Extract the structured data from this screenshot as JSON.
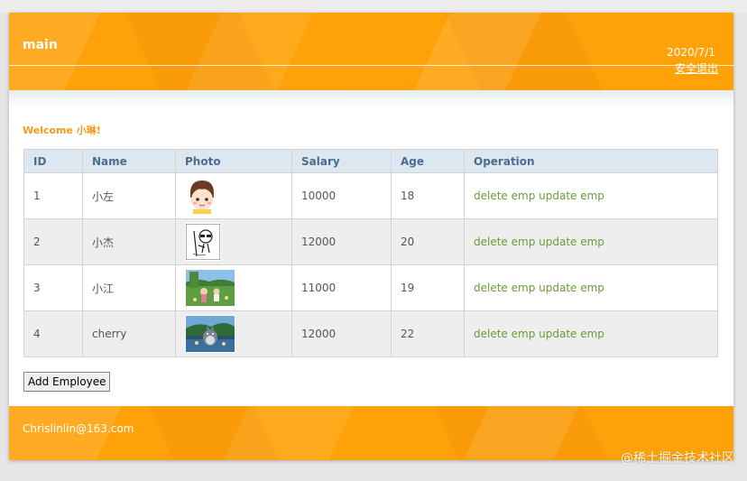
{
  "header": {
    "title": "main",
    "date": "2020/7/1",
    "logout_label": "安全退出"
  },
  "welcome": "Welcome 小琳!",
  "table": {
    "columns": [
      "ID",
      "Name",
      "Photo",
      "Salary",
      "Age",
      "Operation"
    ],
    "rows": [
      {
        "id": "1",
        "name": "小左",
        "photo": "cartoon-child-avatar",
        "salary": "10000",
        "age": "18",
        "delete_label": "delete emp",
        "update_label": "update emp"
      },
      {
        "id": "2",
        "name": "小杰",
        "photo": "cartoon-sketch-avatar",
        "salary": "12000",
        "age": "20",
        "delete_label": "delete emp",
        "update_label": "update emp"
      },
      {
        "id": "3",
        "name": "小江",
        "photo": "anime-field-scene",
        "salary": "11000",
        "age": "19",
        "delete_label": "delete emp",
        "update_label": "update emp"
      },
      {
        "id": "4",
        "name": "cherry",
        "photo": "totoro-scene",
        "salary": "12000",
        "age": "22",
        "delete_label": "delete emp",
        "update_label": "update emp"
      }
    ]
  },
  "add_button_label": "Add Employee",
  "footer": {
    "email": "Chrislinlin@163.com",
    "watermark": "@稀土掘金技术社区"
  },
  "colors": {
    "header_orange": "#ffa20a",
    "welcome_orange": "#f39a1a",
    "table_header_bg": "#dde7f0",
    "table_header_text": "#4a6e8c",
    "operation_link": "#6a9a3a"
  }
}
